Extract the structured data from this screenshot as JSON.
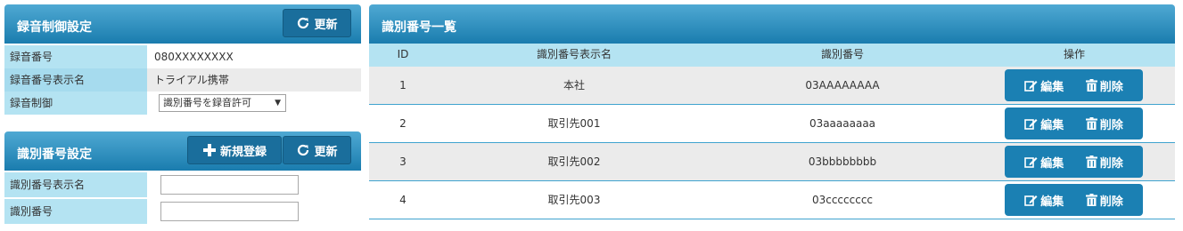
{
  "colors": {
    "header_gradient_top": "#4fa9d3",
    "header_gradient_bottom": "#1a7cae",
    "label_bg": "#b4e3f2",
    "row_alt": "#ebebeb",
    "button": "#1b80b3"
  },
  "recording_panel": {
    "title": "録音制御設定",
    "refresh_label": "更新",
    "rows": [
      {
        "label": "録音番号",
        "value": "080XXXXXXXX"
      },
      {
        "label": "録音番号表示名",
        "value": "トライアル携帯"
      },
      {
        "label": "録音制御",
        "select_value": "識別番号を録音許可"
      }
    ]
  },
  "id_panel": {
    "title": "識別番号設定",
    "new_label": "新規登録",
    "refresh_label": "更新",
    "fields": [
      {
        "label": "識別番号表示名",
        "value": ""
      },
      {
        "label": "識別番号",
        "value": ""
      }
    ]
  },
  "list_panel": {
    "title": "識別番号一覧",
    "columns": [
      "ID",
      "識別番号表示名",
      "識別番号",
      "操作"
    ],
    "rows": [
      {
        "id": "1",
        "name": "本社",
        "number": "03AAAAAAAA"
      },
      {
        "id": "2",
        "name": "取引先001",
        "number": "03aaaaaaaa"
      },
      {
        "id": "3",
        "name": "取引先002",
        "number": "03bbbbbbbb"
      },
      {
        "id": "4",
        "name": "取引先003",
        "number": "03cccccccc"
      }
    ],
    "edit_label": "編集",
    "delete_label": "削除"
  }
}
